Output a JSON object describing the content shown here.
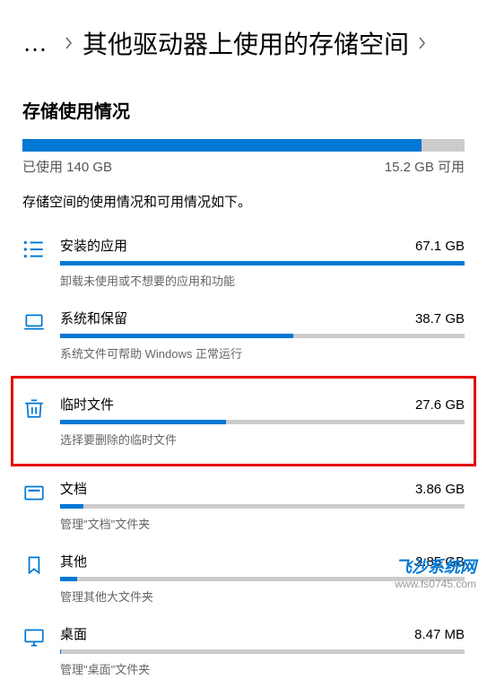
{
  "breadcrumb": {
    "dots": "…",
    "title": "其他驱动器上使用的存储空间"
  },
  "section_title": "存储使用情况",
  "main_stats": {
    "used_label": "已使用 140 GB",
    "free_label": "15.2 GB 可用",
    "fill_percent": 90.2
  },
  "subtitle": "存储空间的使用情况和可用情况如下。",
  "categories": [
    {
      "icon": "apps-list-icon",
      "name": "安装的应用",
      "size": "67.1 GB",
      "desc": "卸载未使用或不想要的应用和功能",
      "fill": 100,
      "highlighted": false
    },
    {
      "icon": "laptop-icon",
      "name": "系统和保留",
      "size": "38.7 GB",
      "desc": "系统文件可帮助 Windows 正常运行",
      "fill": 57.7,
      "highlighted": false
    },
    {
      "icon": "trash-icon",
      "name": "临时文件",
      "size": "27.6 GB",
      "desc": "选择要删除的临时文件",
      "fill": 41.1,
      "highlighted": true
    },
    {
      "icon": "document-icon",
      "name": "文档",
      "size": "3.86 GB",
      "desc": "管理\"文档\"文件夹",
      "fill": 5.8,
      "highlighted": false
    },
    {
      "icon": "bookmark-icon",
      "name": "其他",
      "size": "2.85 GB",
      "desc": "管理其他大文件夹",
      "fill": 4.2,
      "highlighted": false
    },
    {
      "icon": "desktop-icon",
      "name": "桌面",
      "size": "8.47 MB",
      "desc": "管理\"桌面\"文件夹",
      "fill": 0.1,
      "highlighted": false
    }
  ],
  "watermark": {
    "title": "飞沙系统网",
    "url": "www.fs0745.com"
  },
  "colors": {
    "accent": "#0078d4",
    "highlight_border": "#e60000"
  }
}
